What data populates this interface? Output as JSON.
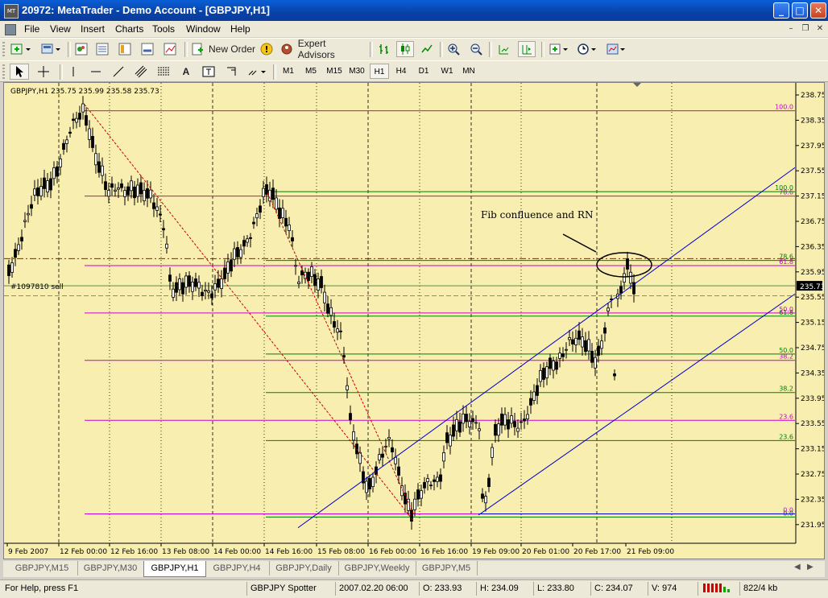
{
  "window": {
    "title": "20972: MetaTrader - Demo Account - [GBPJPY,H1]",
    "app_icon_text": "MT"
  },
  "menu": [
    "File",
    "View",
    "Insert",
    "Charts",
    "Tools",
    "Window",
    "Help"
  ],
  "toolbar": {
    "new_order": "New Order",
    "expert_advisors": "Expert Advisors"
  },
  "timeframes": [
    "M1",
    "M5",
    "M15",
    "M30",
    "H1",
    "H4",
    "D1",
    "W1",
    "MN"
  ],
  "active_timeframe": "H1",
  "chart": {
    "info": "GBPJPY,H1  235.75 235.99 235.58 235.73",
    "sell_label": "#1097810 sell",
    "annotation": "Fib confluence and RN",
    "current_price": "235.73",
    "price_axis": [
      "238.75",
      "238.35",
      "237.95",
      "237.55",
      "237.15",
      "236.75",
      "236.35",
      "235.95",
      "235.55",
      "235.15",
      "234.75",
      "234.35",
      "233.95",
      "233.55",
      "233.15",
      "232.75",
      "232.35",
      "231.95"
    ],
    "time_axis": [
      "9 Feb 2007",
      "12 Feb 00:00",
      "12 Feb 16:00",
      "13 Feb 08:00",
      "14 Feb 00:00",
      "14 Feb 16:00",
      "15 Feb 08:00",
      "16 Feb 00:00",
      "16 Feb 16:00",
      "19 Feb 09:00",
      "20 Feb 01:00",
      "20 Feb 17:00",
      "21 Feb 09:00"
    ],
    "fib1_levels": [
      {
        "label": "100.0",
        "price": 238.5
      },
      {
        "label": "78.6",
        "price": 237.15
      },
      {
        "label": "61.8",
        "price": 236.05
      },
      {
        "label": "50.0",
        "price": 235.3
      },
      {
        "label": "38.2",
        "price": 234.55
      },
      {
        "label": "23.6",
        "price": 233.6
      },
      {
        "label": "0.0",
        "price": 232.12
      }
    ],
    "fib2_levels": [
      {
        "label": "100.0",
        "price": 237.22
      },
      {
        "label": "78.6",
        "price": 236.13
      },
      {
        "label": "61.8",
        "price": 235.25
      },
      {
        "label": "50.0",
        "price": 234.65
      },
      {
        "label": "38.2",
        "price": 234.04
      },
      {
        "label": "23.6",
        "price": 233.28
      },
      {
        "label": "0.0",
        "price": 232.07
      }
    ],
    "colors": {
      "background": "#f7eeb0",
      "fib1": "#cc00cc",
      "fib2": "#008000",
      "channel": "#0000cc",
      "sell_line": "#cc0000",
      "candle": "#000000"
    }
  },
  "tabs": [
    "GBPJPY,M15",
    "GBPJPY,M30",
    "GBPJPY,H1",
    "GBPJPY,H4",
    "GBPJPY,Daily",
    "GBPJPY,Weekly",
    "GBPJPY,M5"
  ],
  "active_tab": "GBPJPY,H1",
  "status": {
    "help": "For Help, press F1",
    "profile": "GBPJPY Spotter",
    "datetime": "2007.02.20 06:00",
    "open": "O: 233.93",
    "high": "H: 234.09",
    "low": "L: 233.80",
    "close": "C: 234.07",
    "volume": "V: 974",
    "traffic": "822/4 kb"
  }
}
